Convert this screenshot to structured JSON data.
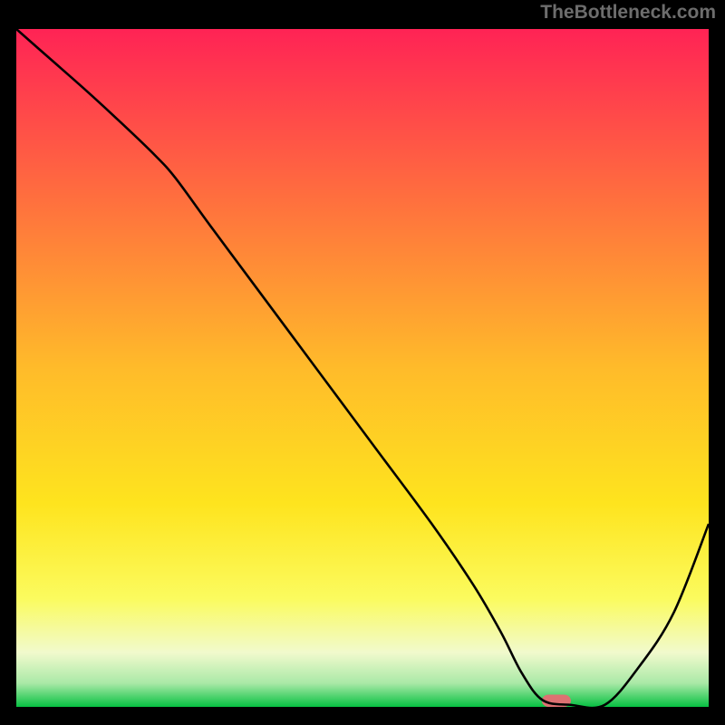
{
  "watermark": "TheBottleneck.com",
  "chart_data": {
    "type": "line",
    "title": "",
    "xlabel": "",
    "ylabel": "",
    "xlim": [
      0,
      100
    ],
    "ylim": [
      0,
      100
    ],
    "grid": false,
    "legend": false,
    "gradient_stops": [
      {
        "offset": 0.0,
        "color": "#ff2355"
      },
      {
        "offset": 0.25,
        "color": "#ff6f3e"
      },
      {
        "offset": 0.5,
        "color": "#ffbb2a"
      },
      {
        "offset": 0.7,
        "color": "#fee41e"
      },
      {
        "offset": 0.84,
        "color": "#fbfb5e"
      },
      {
        "offset": 0.92,
        "color": "#f1facd"
      },
      {
        "offset": 0.965,
        "color": "#aae9a7"
      },
      {
        "offset": 1.0,
        "color": "#07c142"
      }
    ],
    "series": [
      {
        "name": "curve",
        "x": [
          0,
          5,
          10,
          15,
          20,
          23,
          28,
          36,
          44,
          52,
          60,
          66,
          70,
          73,
          76,
          80,
          85,
          90,
          95,
          100
        ],
        "y": [
          100,
          95.5,
          91,
          86.3,
          81.4,
          78,
          71,
          60,
          49,
          38,
          27,
          18,
          11,
          5,
          1,
          0.3,
          0.3,
          6,
          14,
          27
        ]
      }
    ],
    "marker": {
      "x": 78.0,
      "y": 0.9,
      "width_pct": 4.2,
      "height_pct": 1.8,
      "color": "#dd7172"
    }
  }
}
